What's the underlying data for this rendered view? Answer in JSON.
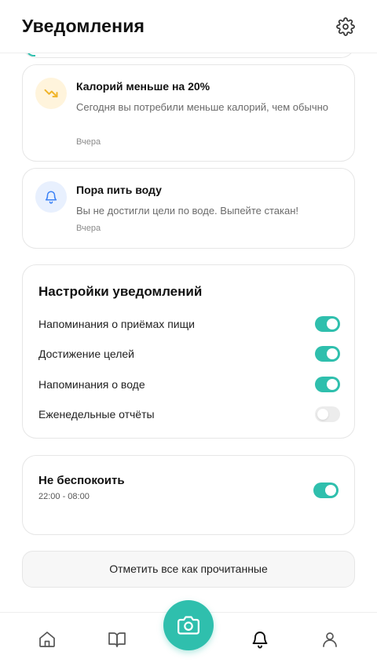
{
  "header": {
    "title": "Уведомления",
    "settings_icon": "gear-icon"
  },
  "notifications": [
    {
      "title": "Калорий меньше на 20%",
      "body": "Сегодня вы потребили меньше калорий, чем обычно",
      "time": "Вчера",
      "icon": "trending-down-icon",
      "icon_color": "#f0b429",
      "icon_bg": "#fff4dc"
    },
    {
      "title": "Пора пить воду",
      "body": "Вы не достигли цели по воде. Выпейте стакан!",
      "time": "Вчера",
      "icon": "bell-icon",
      "icon_color": "#3b82f6",
      "icon_bg": "#e8f0fe"
    }
  ],
  "settings": {
    "title": "Настройки уведомлений",
    "items": [
      {
        "label": "Напоминания о приёмах пищи",
        "enabled": true
      },
      {
        "label": "Достижение целей",
        "enabled": true
      },
      {
        "label": "Напоминания о воде",
        "enabled": true
      },
      {
        "label": "Еженедельные отчёты",
        "enabled": false
      }
    ]
  },
  "do_not_disturb": {
    "title": "Не беспокоить",
    "schedule": "22:00 - 08:00",
    "enabled": true
  },
  "mark_all_read": {
    "label": "Отметить все как прочитанные"
  },
  "bottom_nav": {
    "items": [
      "home-icon",
      "book-icon",
      "camera-icon",
      "bell-icon",
      "user-icon"
    ],
    "active": "bell-icon"
  },
  "colors": {
    "accent": "#2fbfad",
    "toggle_off": "#ececec",
    "text_muted": "#6b6b6b"
  }
}
